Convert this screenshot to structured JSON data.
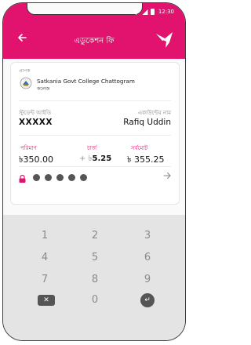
{
  "status": {
    "time": "12:30"
  },
  "app_bar": {
    "title": "এডুকেশন ফি"
  },
  "receiver": {
    "label": "প্রাপক",
    "name": "Satkania Govt College Chattogram",
    "sub": "কলেজ"
  },
  "student": {
    "id_label": "স্টুডেন্ট আইডি",
    "id_value": "XXXXX",
    "name_label": "একাউন্টের নাম",
    "name_value": "Rafiq Uddin"
  },
  "payment": {
    "amount_label": "পরিমাণ",
    "amount_value": "৳350.00",
    "charge_label": "চার্জ",
    "charge_prefix": "+ ৳",
    "charge_value": "5.25",
    "total_label": "সর্বমোট",
    "total_value": "৳ 355.25"
  },
  "pin": {
    "dots": 5
  },
  "keypad": {
    "keys": [
      "1",
      "2",
      "3",
      "4",
      "5",
      "6",
      "7",
      "8",
      "9",
      "0"
    ],
    "delete_label": "✕",
    "enter_label": "↵"
  },
  "colors": {
    "brand": "#e2136e"
  },
  "icons": {
    "back": "arrow-left-icon",
    "logo": "bkash-bird-icon",
    "lock": "lock-icon",
    "next": "arrow-right-icon"
  }
}
